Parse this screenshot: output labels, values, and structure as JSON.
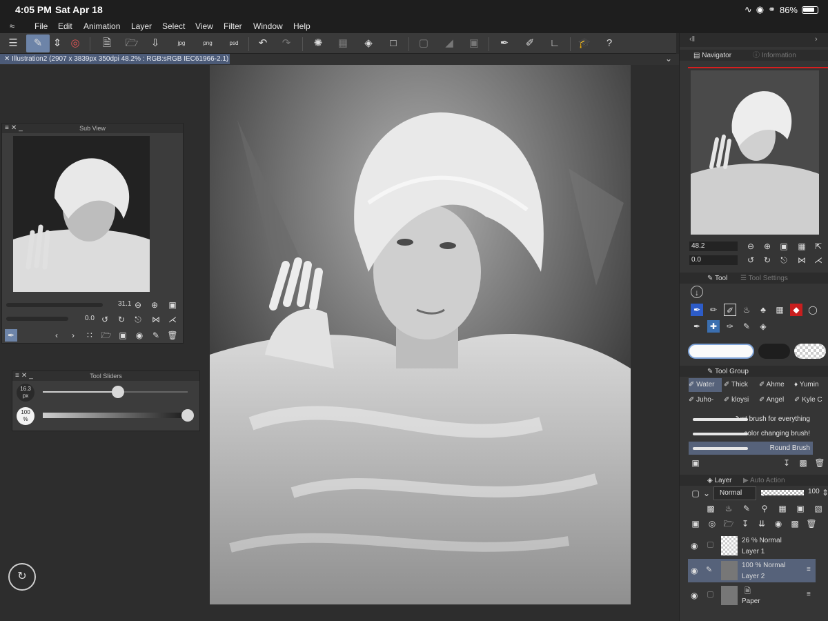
{
  "status": {
    "time": "4:05 PM",
    "date": "Sat Apr 18",
    "battery": "86%"
  },
  "menu": {
    "items": [
      "File",
      "Edit",
      "Animation",
      "Layer",
      "Select",
      "View",
      "Filter",
      "Window",
      "Help"
    ]
  },
  "toolbar": {
    "icons": [
      "menu-icon",
      "brush-tool-icon",
      "up-down-icon",
      "snap-icon",
      "new-file-icon",
      "open-folder-icon",
      "save-icon",
      "export-jpg-icon",
      "export-png-icon",
      "export-psd-icon",
      "undo-icon",
      "redo-icon",
      "loading-icon",
      "transform-icon",
      "fill-icon",
      "crop-icon",
      "clear-selection-icon",
      "invert-icon",
      "select-icon",
      "pen-icon",
      "smooth-icon",
      "ruler-icon",
      "tutorial-icon",
      "help-icon"
    ],
    "jpg_label": "jpg",
    "png_label": "png",
    "psd_label": "psd"
  },
  "document": {
    "tab_label": "Illustration2 (2907 x 3839px 350dpi 48.2% : RGB:sRGB IEC61966-2.1)"
  },
  "subview": {
    "title": "Sub View",
    "zoom": "31.1",
    "rotation": "0.0"
  },
  "tool_sliders": {
    "title": "Tool Sliders",
    "size_value": "16.3",
    "size_unit": "px",
    "opacity_value": "100",
    "opacity_unit": "%",
    "size_level": 0.52,
    "opacity_level": 1.0
  },
  "navigator": {
    "tab": "Navigator",
    "info_tab": "Information",
    "zoom": "48.2",
    "rotation": "0.0"
  },
  "tool_panel": {
    "tab": "Tool",
    "settings_tab": "Tool Settings"
  },
  "tool_group": {
    "title": "Tool Group",
    "items": [
      "Water",
      "Thick",
      "Ahme",
      "Yumin",
      "Juho-",
      "kloysi",
      "Angel",
      "Kyle C"
    ],
    "brushes": [
      "Just brush for everything",
      "color changing brush!",
      "Round Brush"
    ]
  },
  "layer_panel": {
    "tab": "Layer",
    "auto_tab": "Auto Action",
    "blend_mode": "Normal",
    "opacity": "100",
    "layers": [
      {
        "info": "26 %  Normal",
        "name": "Layer 1"
      },
      {
        "info": "100 %  Normal",
        "name": "Layer 2"
      },
      {
        "info": "",
        "name": "Paper"
      }
    ]
  },
  "colors": {
    "accent": "#6d84a8",
    "selected_row": "#56627a",
    "navigator_line": "#d81e1e"
  }
}
